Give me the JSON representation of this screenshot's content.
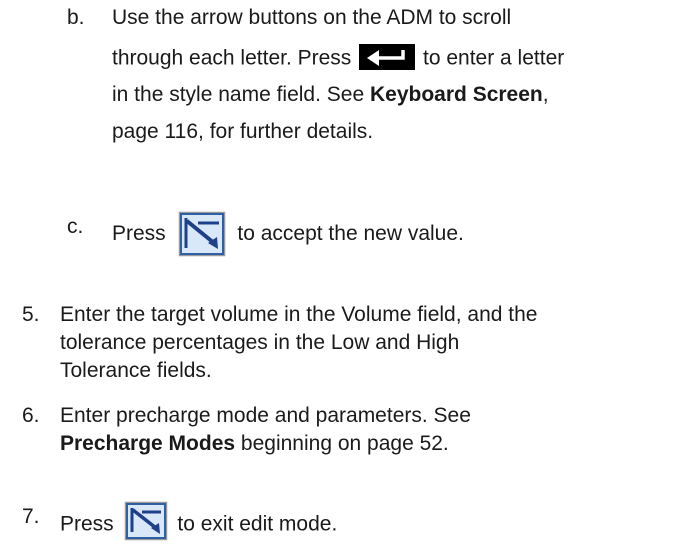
{
  "steps": {
    "b": {
      "marker": "b.",
      "line1": "Use the arrow buttons on the ADM to scroll",
      "line2_pre": "through each letter. Press",
      "line2_post": "to enter a letter",
      "line3_pre": "in the style name field. See",
      "line3_bold": "Keyboard Screen",
      "line3_post": ",",
      "line4": "page 116, for further details."
    },
    "c": {
      "marker": "c.",
      "pre": "Press",
      "post": "to accept the new value."
    },
    "s5": {
      "marker": "5.",
      "line1": "Enter the target volume in the Volume field, and the",
      "line2": "tolerance percentages in the Low and High",
      "line3": "Tolerance fields."
    },
    "s6": {
      "marker": "6.",
      "line1": "Enter precharge mode and parameters. See",
      "line2_bold": "Precharge Modes",
      "line2_post": " beginning on page 52."
    },
    "s7": {
      "marker": "7.",
      "pre": "Press",
      "post": "to exit edit mode."
    }
  },
  "icons": {
    "enter": "enter-key-icon",
    "accept_edit": "accept-edit-icon",
    "exit_edit": "exit-edit-icon"
  },
  "colors": {
    "text": "#1a1a1a",
    "icon_frame": "#2f5fa5",
    "icon_fill": "#d9e8f8",
    "icon_symbol": "#1e3f8a"
  }
}
